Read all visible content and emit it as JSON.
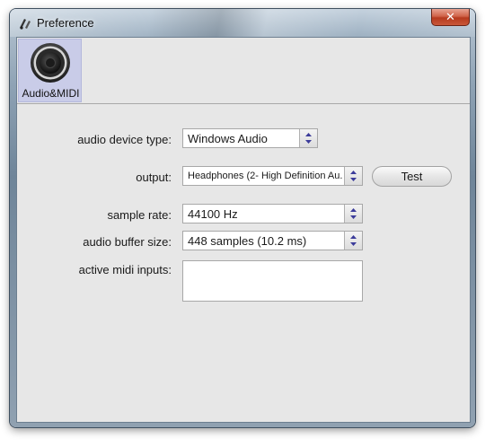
{
  "window": {
    "title": "Preference",
    "close_symbol": "✕"
  },
  "tabs": [
    {
      "label": "Audio&MIDI",
      "icon": "speaker-icon",
      "selected": true
    }
  ],
  "settings": {
    "audio_device_type": {
      "label": "audio device type:",
      "value": "Windows Audio"
    },
    "output": {
      "label": "output:",
      "value": "Headphones (2- High Definition Au..."
    },
    "test_button": "Test",
    "sample_rate": {
      "label": "sample rate:",
      "value": "44100 Hz"
    },
    "buffer_size": {
      "label": "audio buffer size:",
      "value": "448 samples (10.2 ms)"
    },
    "midi_inputs": {
      "label": "active midi inputs:"
    }
  },
  "colors": {
    "tab_selected": "#c9cce8",
    "client_bg": "#e7e7e7",
    "close_button": "#c9583a"
  }
}
